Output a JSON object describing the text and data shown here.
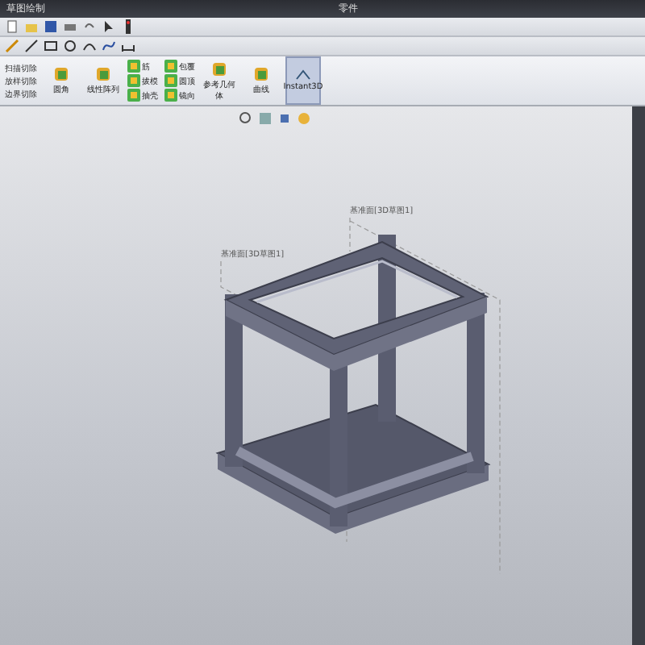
{
  "window": {
    "title": "零件",
    "sketch_tab": "草图绘制"
  },
  "ribbon": {
    "cut_commands": [
      "扫描切除",
      "放样切除",
      "边界切除"
    ],
    "buttons": [
      {
        "kind": "large",
        "label": "圆角"
      },
      {
        "kind": "large",
        "label": "线性阵列"
      },
      {
        "kind": "stack",
        "items": [
          "筋",
          "拔模",
          "抽壳"
        ]
      },
      {
        "kind": "stack",
        "items": [
          "包覆",
          "圆顶",
          "镜向"
        ]
      },
      {
        "kind": "large",
        "label": "参考几何体"
      },
      {
        "kind": "large",
        "label": "曲线"
      }
    ],
    "instant3d": {
      "label": "Instant3D",
      "selected": true
    }
  },
  "plane_labels": [
    "基准面[3D草图1]",
    "基准面[3D草图1]"
  ]
}
